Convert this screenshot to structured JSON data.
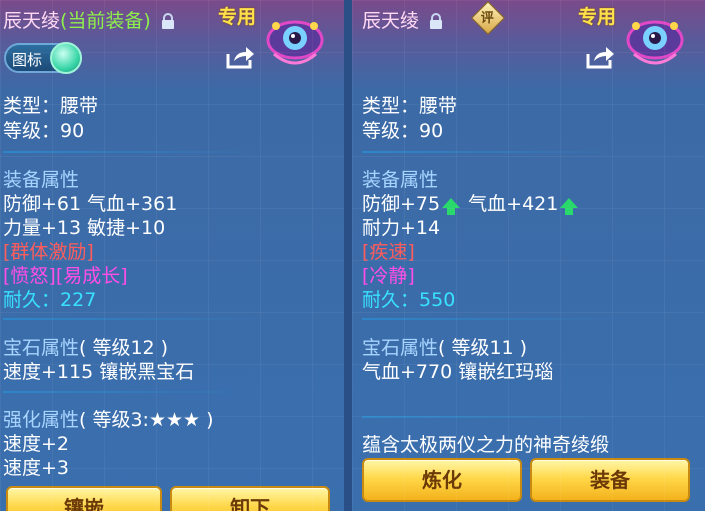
{
  "left": {
    "title": "辰天绫",
    "title_suffix": "(当前装备)",
    "special": "专用",
    "toggle_label": "图标",
    "type_line": "类型：腰带",
    "level_line": "等级：90",
    "attr_header": "装备属性",
    "attr_line1": "防御+61 气血+361",
    "attr_line2": "力量+13 敏捷+10",
    "skill1": "[群体激励]",
    "skill2": "[愤怒][易成长]",
    "durability_label": "耐久：",
    "durability_value": "227",
    "gem_header": "宝石属性",
    "gem_level": "( 等级12 )",
    "gem_line": "速度+115 镶嵌黑宝石",
    "enhance_header": "强化属性",
    "enhance_level": "( 等级3:★★★ )",
    "enhance_line1": "速度+2",
    "enhance_line2": "速度+3",
    "button_inlay": "镶嵌",
    "button_unequip": "卸下"
  },
  "right": {
    "title": "辰天绫",
    "eval_badge": "评",
    "special": "专用",
    "type_line": "类型：腰带",
    "level_line": "等级：90",
    "attr_header": "装备属性",
    "attr_def": "防御+75",
    "attr_hp": "气血+421",
    "attr_line2": "耐力+14",
    "skill1": "[疾速]",
    "skill2": "[冷静]",
    "durability_label": "耐久：",
    "durability_value": "550",
    "gem_header": "宝石属性",
    "gem_level": "( 等级11 )",
    "gem_line": "气血+770 镶嵌红玛瑙",
    "description": "蕴含太极两仪之力的神奇绫缎",
    "button_refine": "炼化",
    "button_equip": "装备"
  },
  "colors": {
    "title": "#ffd8f4",
    "equipped_tag": "#8ef04a",
    "special": "#ffe14a",
    "section_header": "#a7d4ff",
    "durability": "#38e2ff",
    "skill_red": "#ff5c5c",
    "skill_magenta": "#ff4de8",
    "arrow_up": "#29d96b",
    "button_gold": "#ffd84a"
  },
  "icons": [
    "lock-icon",
    "share-icon",
    "pet-icon",
    "toggle-knob",
    "eval-badge",
    "up-arrow-icon"
  ]
}
